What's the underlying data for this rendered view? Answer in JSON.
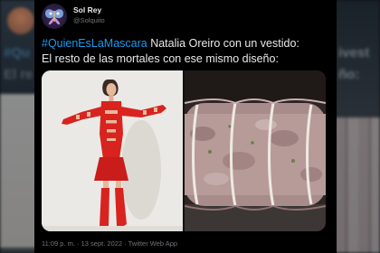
{
  "tweet": {
    "author_name": "Sol Rey",
    "author_handle": "@Solquito",
    "hashtag": "#QuienEsLaMascara",
    "text_line1_rest": " Natalia Oreiro con un vestido:",
    "text_line2": "El resto de las mortales con ese mismo diseño:",
    "timestamp": "11:09 p. m. · 13 sept. 2022 · Twitter Web App"
  },
  "background": {
    "left_ghost_text1": "#Qu",
    "left_ghost_text2": "El re",
    "right_ghost_text1": "ivest",
    "right_ghost_text2": "ño:"
  },
  "media": {
    "left_photo": "woman-in-red-cutout-dress",
    "right_photo": "tied-rolled-meat-roast"
  },
  "colors": {
    "background": "#000000",
    "text": "#e7e9ea",
    "hashtag": "#1d9bf0",
    "muted": "#71767b",
    "dress_red": "#d8231f"
  }
}
